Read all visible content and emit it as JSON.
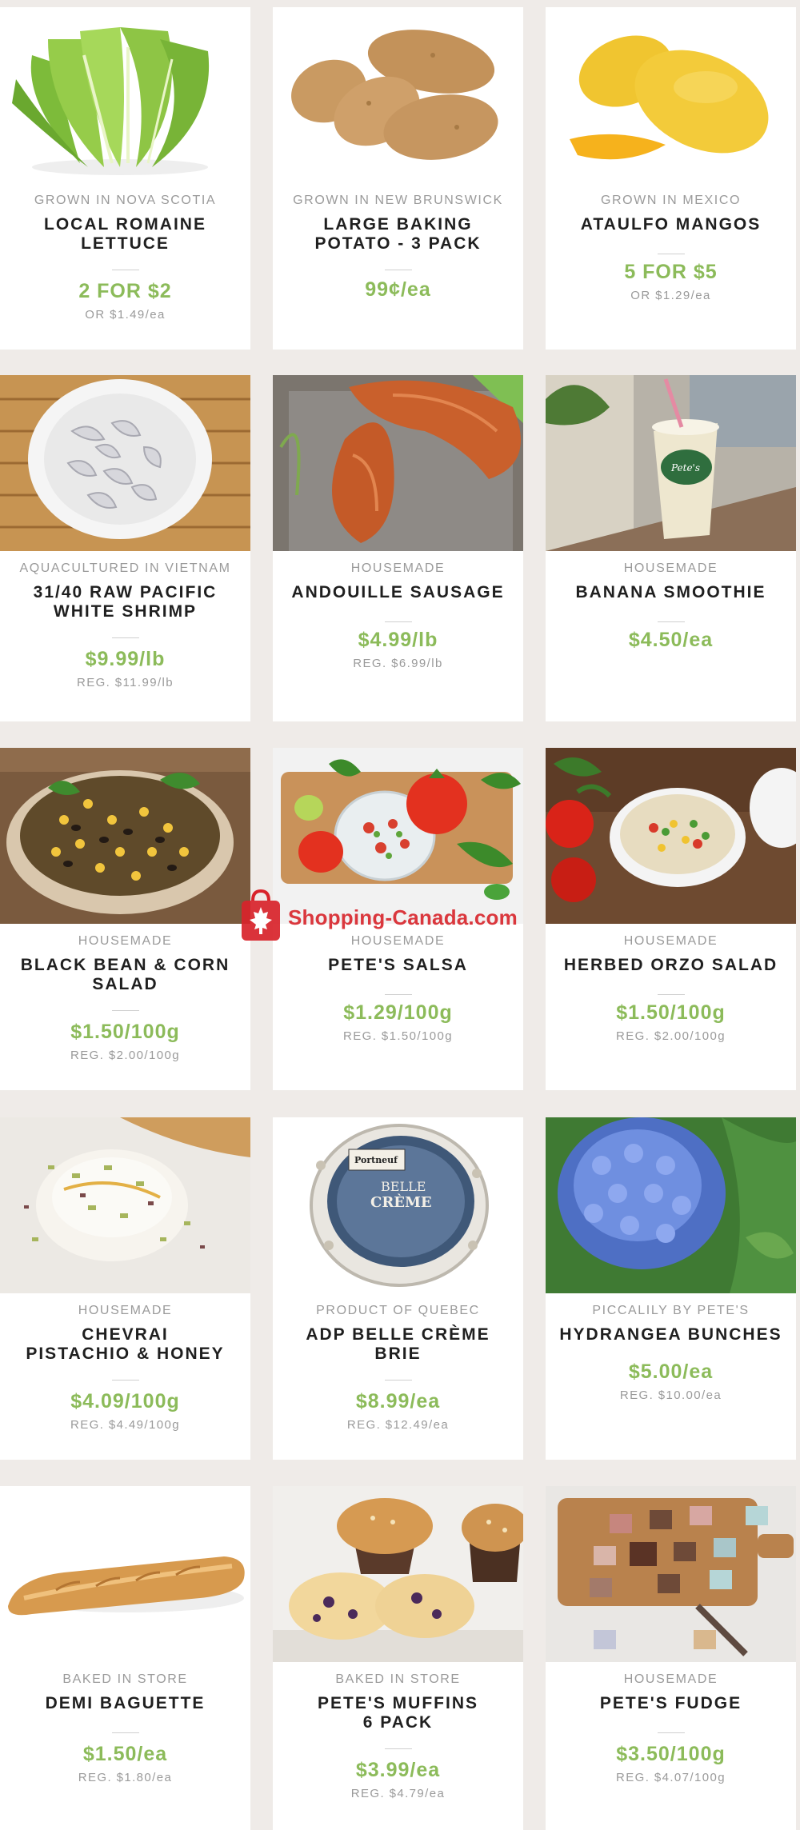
{
  "products": [
    {
      "origin": "GROWN IN NOVA SCOTIA",
      "name_lines": [
        "LOCAL ROMAINE",
        "LETTUCE"
      ],
      "price": "2 FOR $2",
      "reg": "OR $1.49/ea",
      "image": "romaine-lettuce"
    },
    {
      "origin": "GROWN IN NEW BRUNSWICK",
      "name_lines": [
        "LARGE BAKING",
        "POTATO - 3 PACK"
      ],
      "price": "99¢/ea",
      "reg": "",
      "image": "potatoes"
    },
    {
      "origin": "GROWN IN MEXICO",
      "name_lines": [
        "ATAULFO MANGOS"
      ],
      "price": "5 FOR $5",
      "reg": "OR $1.29/ea",
      "image": "mangos"
    },
    {
      "origin": "AQUACULTURED IN VIETNAM",
      "name_lines": [
        "31/40 RAW PACIFIC",
        "WHITE SHRIMP"
      ],
      "price": "$9.99/lb",
      "reg": "REG. $11.99/lb",
      "image": "shrimp-bowl"
    },
    {
      "origin": "HOUSEMADE",
      "name_lines": [
        "ANDOUILLE SAUSAGE"
      ],
      "price": "$4.99/lb",
      "reg": "REG. $6.99/lb",
      "image": "sausages"
    },
    {
      "origin": "HOUSEMADE",
      "name_lines": [
        "BANANA SMOOTHIE"
      ],
      "price": "$4.50/ea",
      "reg": "",
      "image": "smoothie-cup"
    },
    {
      "origin": "HOUSEMADE",
      "name_lines": [
        "BLACK BEAN & CORN",
        "SALAD"
      ],
      "price": "$1.50/100g",
      "reg": "REG. $2.00/100g",
      "image": "bean-corn-salad"
    },
    {
      "origin": "HOUSEMADE",
      "name_lines": [
        "PETE'S SALSA"
      ],
      "price": "$1.29/100g",
      "reg": "REG. $1.50/100g",
      "image": "salsa"
    },
    {
      "origin": "HOUSEMADE",
      "name_lines": [
        "HERBED ORZO SALAD"
      ],
      "price": "$1.50/100g",
      "reg": "REG. $2.00/100g",
      "image": "orzo-salad"
    },
    {
      "origin": "HOUSEMADE",
      "name_lines": [
        "CHEVRAI",
        "PISTACHIO & HONEY"
      ],
      "price": "$4.09/100g",
      "reg": "REG. $4.49/100g",
      "image": "chevrai"
    },
    {
      "origin": "PRODUCT OF QUEBEC",
      "name_lines": [
        "ADP BELLE CRÈME",
        "BRIE"
      ],
      "price": "$8.99/ea",
      "reg": "REG. $12.49/ea",
      "image": "brie-wheel",
      "label_lines": [
        "Portneuf",
        "BELLE",
        "CRÈME"
      ]
    },
    {
      "origin": "PICCALILY BY PETE'S",
      "name_lines": [
        "HYDRANGEA BUNCHES"
      ],
      "price": "$5.00/ea",
      "reg": "REG. $10.00/ea",
      "image": "hydrangea"
    },
    {
      "origin": "BAKED IN STORE",
      "name_lines": [
        "DEMI BAGUETTE"
      ],
      "price": "$1.50/ea",
      "reg": "REG. $1.80/ea",
      "image": "baguette"
    },
    {
      "origin": "BAKED IN STORE",
      "name_lines": [
        "PETE'S MUFFINS",
        "6 PACK"
      ],
      "price": "$3.99/ea",
      "reg": "REG. $4.79/ea",
      "image": "muffins"
    },
    {
      "origin": "HOUSEMADE",
      "name_lines": [
        "PETE'S FUDGE"
      ],
      "price": "$3.50/100g",
      "reg": "REG. $4.07/100g",
      "image": "fudge-board"
    }
  ],
  "smoothie_cup_label": "Pete's",
  "watermark": {
    "text": "Shopping-Canada.com",
    "icon": "shopping-bag-maple-leaf-icon",
    "color": "#d8232a"
  },
  "colors": {
    "price": "#8cbb5a",
    "background": "#efebe8"
  }
}
